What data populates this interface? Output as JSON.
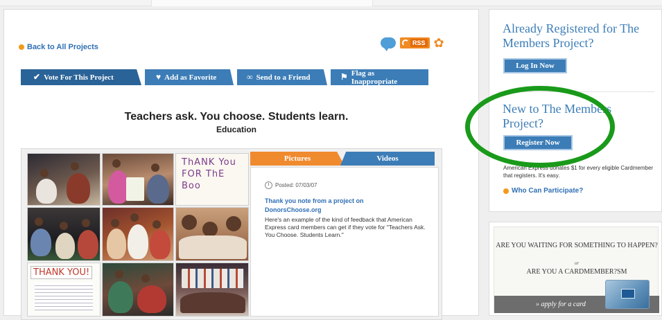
{
  "main": {
    "back_link": "Back to All Projects",
    "share": {
      "rss_label": "RSS"
    },
    "actions": {
      "vote": "Vote For This Project",
      "favorite": "Add as Favorite",
      "send": "Send to a Friend",
      "flag": "Flag as Inappropriate"
    },
    "headline": "Teachers ask. You choose. Students learn.",
    "category": "Education",
    "media": {
      "tabs": [
        "Pictures",
        "Videos"
      ],
      "photo_texts": {
        "thank_you_card": "ThANK You FOR ThE Boo",
        "thank_you_letter": "THANK YOU!"
      }
    },
    "post": {
      "posted": "Posted: 07/03/07",
      "title": "Thank you note from a project on DonorsChoose.org",
      "body": "Here's an example of the kind of feedback that American Express card members can get if they vote for \"Teachers Ask. You Choose. Students Learn.\""
    }
  },
  "sidebar": {
    "already_title": "Already Registered for The Members Project?",
    "login_button": "Log In Now",
    "new_title": "New to The Members Project?",
    "register_button": "Register Now",
    "amex_note": "American Express donates $1 for every eligible Cardmember that registers. It's easy.",
    "who_link": "Who Can Participate?"
  },
  "ad": {
    "line1": "ARE YOU WAITING FOR SOMETHING TO HAPPEN?",
    "or": "or",
    "line2": "ARE YOU A CARDMEMBER?SM",
    "cta": "» apply for a card"
  },
  "colors": {
    "brand_blue": "#3c7db7",
    "accent_orange": "#f08a2e",
    "link_blue": "#2f6fb4",
    "highlight_ring": "#1a9a1a"
  }
}
